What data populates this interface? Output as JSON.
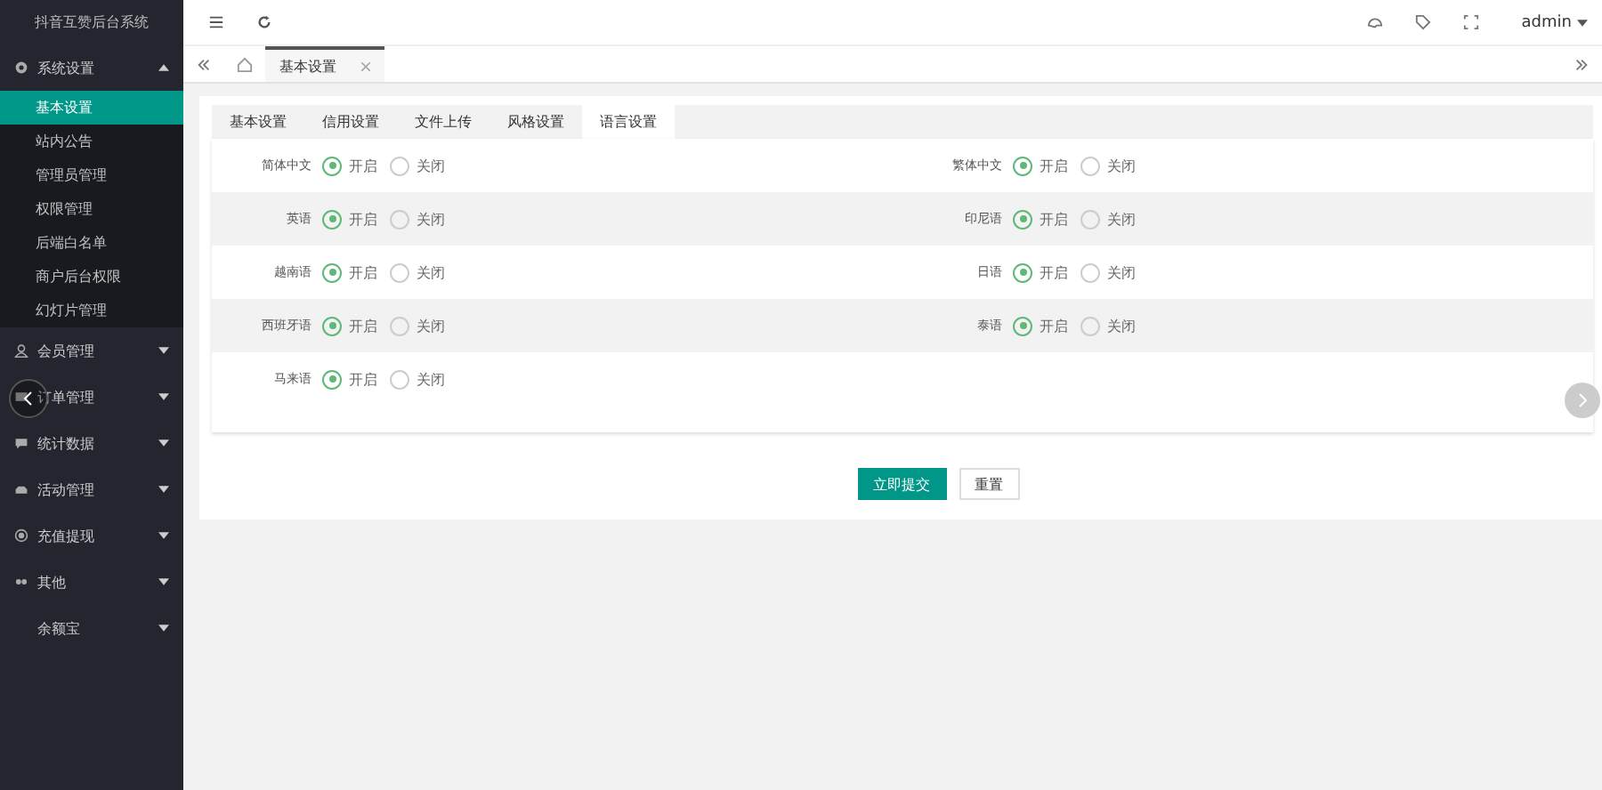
{
  "app_title": "抖音互赞后台系统",
  "sidebar": [
    {
      "label": "系统设置",
      "expanded": true,
      "children": [
        {
          "label": "基本设置",
          "selected": true
        },
        {
          "label": "站内公告",
          "selected": false
        },
        {
          "label": "管理员管理",
          "selected": false
        },
        {
          "label": "权限管理",
          "selected": false
        },
        {
          "label": "后端白名单",
          "selected": false
        },
        {
          "label": "商户后台权限",
          "selected": false
        },
        {
          "label": "幻灯片管理",
          "selected": false
        }
      ]
    },
    {
      "label": "会员管理",
      "expanded": false
    },
    {
      "label": "订单管理",
      "expanded": false
    },
    {
      "label": "统计数据",
      "expanded": false
    },
    {
      "label": "活动管理",
      "expanded": false
    },
    {
      "label": "充值提现",
      "expanded": false
    },
    {
      "label": "其他",
      "expanded": false
    },
    {
      "label": "余额宝",
      "expanded": false
    }
  ],
  "user": "admin",
  "page_tabs": [
    {
      "label": "基本设置",
      "selected": true
    }
  ],
  "settings_tabs": [
    {
      "label": "基本设置",
      "selected": false
    },
    {
      "label": "信用设置",
      "selected": false
    },
    {
      "label": "文件上传",
      "selected": false
    },
    {
      "label": "风格设置",
      "selected": false
    },
    {
      "label": "语言设置",
      "selected": true
    }
  ],
  "rows": [
    [
      {
        "label": "简体中文",
        "options": [
          {
            "label": "开启",
            "selected": true
          },
          {
            "label": "关闭",
            "selected": false
          }
        ]
      },
      {
        "label": "繁体中文",
        "options": [
          {
            "label": "开启",
            "selected": true
          },
          {
            "label": "关闭",
            "selected": false
          }
        ]
      }
    ],
    [
      {
        "label": "英语",
        "options": [
          {
            "label": "开启",
            "selected": true
          },
          {
            "label": "关闭",
            "selected": false
          }
        ]
      },
      {
        "label": "印尼语",
        "options": [
          {
            "label": "开启",
            "selected": true
          },
          {
            "label": "关闭",
            "selected": false
          }
        ]
      }
    ],
    [
      {
        "label": "越南语",
        "options": [
          {
            "label": "开启",
            "selected": true
          },
          {
            "label": "关闭",
            "selected": false
          }
        ]
      },
      {
        "label": "日语",
        "options": [
          {
            "label": "开启",
            "selected": true
          },
          {
            "label": "关闭",
            "selected": false
          }
        ]
      }
    ],
    [
      {
        "label": "西班牙语",
        "options": [
          {
            "label": "开启",
            "selected": true
          },
          {
            "label": "关闭",
            "selected": false
          }
        ]
      },
      {
        "label": "泰语",
        "options": [
          {
            "label": "开启",
            "selected": true
          },
          {
            "label": "关闭",
            "selected": false
          }
        ]
      }
    ],
    [
      {
        "label": "马来语",
        "options": [
          {
            "label": "开启",
            "selected": true
          },
          {
            "label": "关闭",
            "selected": false
          }
        ]
      }
    ]
  ],
  "buttons": [
    {
      "label": "立即提交",
      "kind": "primary"
    },
    {
      "label": "重置",
      "kind": "default"
    }
  ]
}
